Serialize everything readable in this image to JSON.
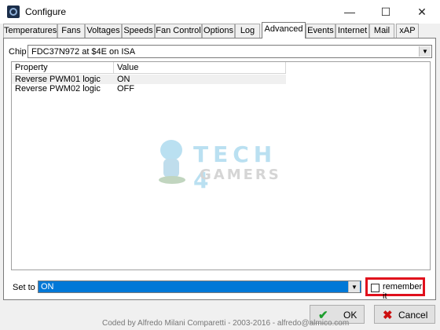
{
  "window": {
    "title": "Configure",
    "minimize": "—",
    "maximize": "☐",
    "close": "✕"
  },
  "tabs": [
    {
      "label": "Temperatures"
    },
    {
      "label": "Fans"
    },
    {
      "label": "Voltages"
    },
    {
      "label": "Speeds"
    },
    {
      "label": "Fan Control"
    },
    {
      "label": "Options"
    },
    {
      "label": "Log"
    },
    {
      "label": "Advanced",
      "active": true
    },
    {
      "label": "Events"
    },
    {
      "label": "Internet"
    },
    {
      "label": "Mail"
    },
    {
      "label": "xAP"
    }
  ],
  "chip": {
    "label": "Chip",
    "value": "FDC37N972 at $4E on ISA"
  },
  "table": {
    "columns": [
      "Property",
      "Value"
    ],
    "rows": [
      {
        "property": "Reverse PWM01 logic",
        "value": "ON"
      },
      {
        "property": "Reverse PWM02 logic",
        "value": "OFF"
      }
    ]
  },
  "watermark": {
    "line1": "TECH 4",
    "line2": "GAMERS"
  },
  "set_to": {
    "label": "Set to",
    "value": "ON"
  },
  "remember": {
    "label": "remember it",
    "checked": false
  },
  "buttons": {
    "ok": "OK",
    "cancel": "Cancel"
  },
  "footer": "Coded by Alfredo Milani Comparetti - 2003-2016 - alfredo@almico.com",
  "colors": {
    "selection": "#0078d7",
    "highlight_box": "#e0101c",
    "ok_icon": "#1e9e2e",
    "cancel_icon": "#cc1010"
  }
}
